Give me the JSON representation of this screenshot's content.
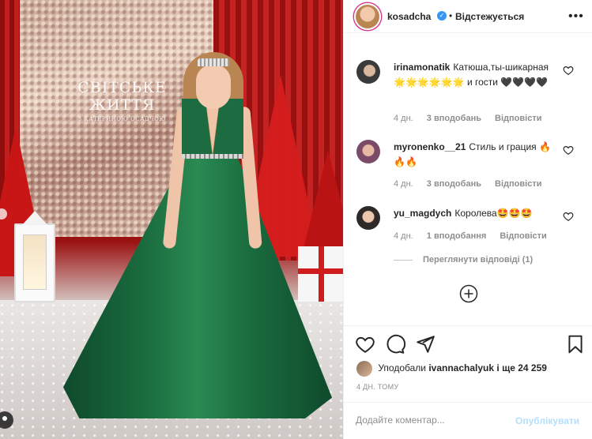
{
  "post": {
    "author": "kosadcha",
    "separator": "•",
    "follow_label": "Відстежується",
    "more_icon": "more-horizontal-icon",
    "verified_icon": "verified-badge-icon",
    "show_logo": {
      "line1": "СВІТСЬКЕ",
      "line2": "ЖИТТЯ",
      "line3": "З КАТЕРИНОЮ ОСАДЧОЮ"
    }
  },
  "comments": [
    {
      "user": "irinamonatik",
      "text": "Катюша,ты-шикарная🌟🌟🌟🌟🌟🌟 и гости 🖤🖤🖤🖤",
      "age": "4 дн.",
      "likes": "3 вподобань",
      "reply": "Відповісти"
    },
    {
      "user": "myronenko__21",
      "text": "Стиль и грация 🔥🔥🔥",
      "age": "4 дн.",
      "likes": "3 вподобань",
      "reply": "Відповісти"
    },
    {
      "user": "yu_magdych",
      "text": "Королева🤩🤩🤩",
      "age": "4 дн.",
      "likes": "1 вподобання",
      "reply": "Відповісти"
    }
  ],
  "view_replies": "Переглянути відповіді (1)",
  "actions": {
    "like_icon": "heart-icon",
    "comment_icon": "comment-icon",
    "share_icon": "send-icon",
    "save_icon": "bookmark-icon",
    "load_more_icon": "plus-circle-icon"
  },
  "likes": {
    "prefix": "Уподобали",
    "user": "ivannachalyuk",
    "suffix": "і ще 24 259"
  },
  "timestamp": "4 ДН. ТОМУ",
  "comment_box": {
    "placeholder": "Додайте коментар...",
    "post_label": "Опублікувати"
  },
  "colors": {
    "verified": "#3897f0",
    "post_disabled": "#b2dffc",
    "meta": "#8e8e8e",
    "dress": "#1a6b3e"
  }
}
